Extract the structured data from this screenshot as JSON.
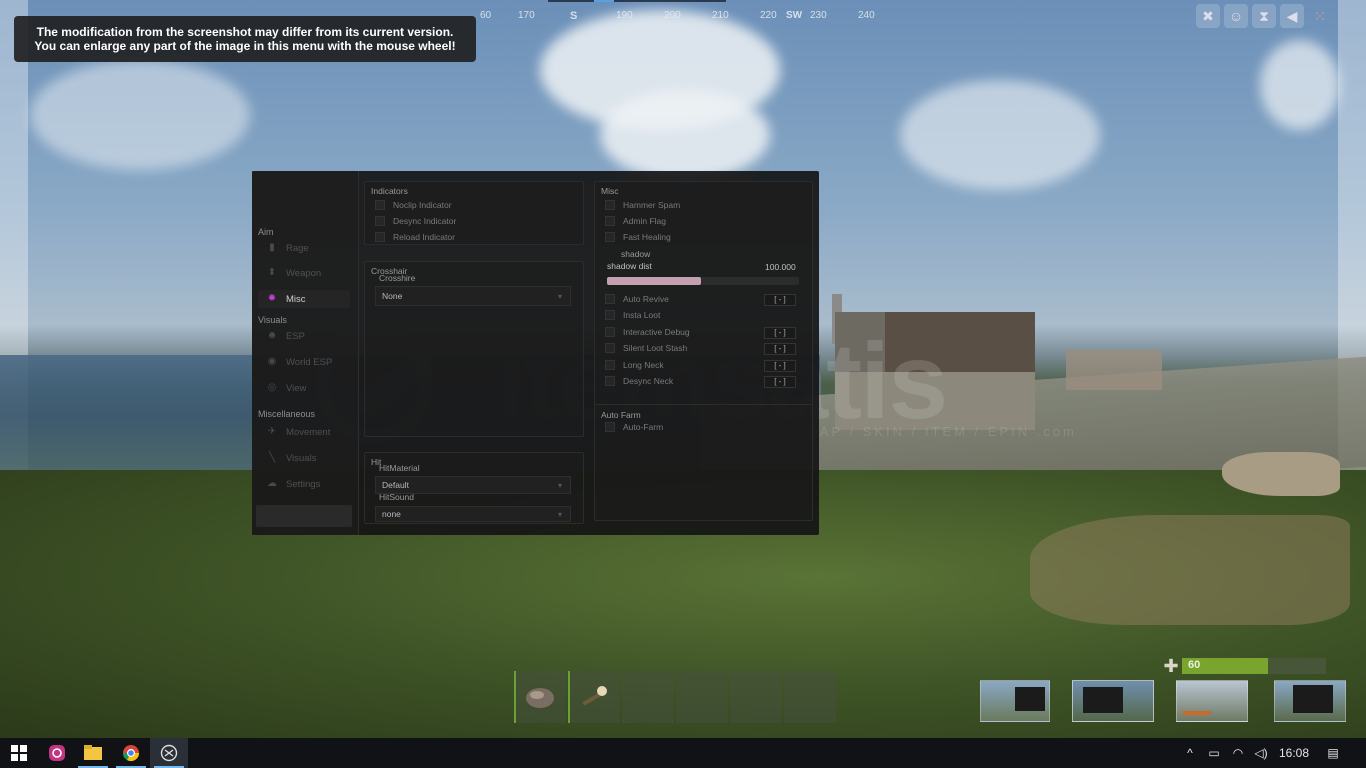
{
  "notice": {
    "line1": "The modification from the screenshot may differ from its current version.",
    "line2": "You can enlarge any part of the image in this menu with the mouse wheel!"
  },
  "compass": {
    "labels": [
      "60",
      "170",
      "S",
      "190",
      "200",
      "210",
      "220",
      "SW",
      "230",
      "240"
    ]
  },
  "menu": {
    "sections": {
      "aim": "Aim",
      "visuals": "Visuals",
      "miscellaneous": "Miscellaneous"
    },
    "nav": {
      "rage": "Rage",
      "weapon": "Weapon",
      "misc": "Misc",
      "esp": "ESP",
      "world_esp": "World ESP",
      "view": "View",
      "movement": "Movement",
      "visuals": "Visuals",
      "settings": "Settings"
    },
    "indicators": {
      "title": "Indicators",
      "items": [
        "Noclip Indicator",
        "Desync Indicator",
        "Reload Indicator"
      ]
    },
    "crosshair": {
      "title": "Crosshair",
      "sublabel": "Crosshire",
      "value": "None"
    },
    "hit": {
      "title": "Hit",
      "material_label": "HitMaterial",
      "material_value": "Default",
      "sound_label": "HitSound",
      "sound_value": "none"
    },
    "misc": {
      "title": "Misc",
      "top_items": [
        "Hammer Spam",
        "Admin Flag",
        "Fast Healing"
      ],
      "shadow_label": "shadow",
      "shadow_dist_label": "shadow dist",
      "shadow_dist_value": "100.000",
      "shadow_fill_fraction": 0.49,
      "items": [
        {
          "label": "Auto Revive",
          "key": "[ - ]"
        },
        {
          "label": "Insta Loot",
          "key": ""
        },
        {
          "label": "Interactive Debug",
          "key": "[ - ]"
        },
        {
          "label": "Silent Loot Stash",
          "key": "[ - ]"
        },
        {
          "label": "Long Neck",
          "key": "[ - ]"
        },
        {
          "label": "Desync Neck",
          "key": "[ - ]"
        }
      ],
      "autofarm_title": "Auto Farm",
      "autofarm_item": "Auto-Farm"
    }
  },
  "watermark": {
    "brand": "itemsatis",
    "sub": "HESAP / SKIN / ITEM / EPIN .com"
  },
  "hud": {
    "health": "60",
    "health_fraction": 0.6,
    "hotbar_slots": 6
  },
  "taskbar": {
    "clock": "16:08",
    "apps": [
      "start-icon",
      "instagram-icon",
      "file-explorer-icon",
      "chrome-icon",
      "app-icon"
    ]
  },
  "colors": {
    "accent": "#c13fd0",
    "slider": "#c49fb0",
    "health": "#79a52e",
    "taskbar": "#101216"
  }
}
